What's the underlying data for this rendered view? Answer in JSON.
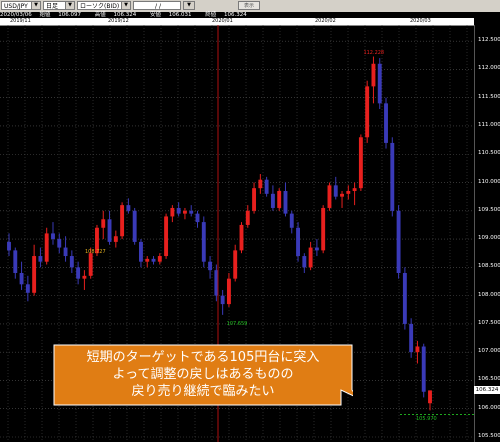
{
  "toolbar": {
    "symbol": "USD/JPY",
    "timeframe": "日足",
    "price_type": "ローソク(BID)",
    "date_input": "/ /",
    "show_button": "表示"
  },
  "info": {
    "date": "2020/03/06",
    "open_label": "始値",
    "open": "106.097",
    "high_label": "高値",
    "high": "106.324",
    "low_label": "安値",
    "low": "106.031",
    "close_label": "終値",
    "close": "106.324"
  },
  "date_axis": [
    "2019/11",
    "2019/12",
    "2020/01",
    "2020/02",
    "2020/03"
  ],
  "price_axis": [
    "112.500",
    "112.000",
    "111.500",
    "111.000",
    "110.500",
    "110.000",
    "109.500",
    "109.000",
    "108.500",
    "108.000",
    "107.500",
    "107.000",
    "106.500",
    "106.000",
    "105.500"
  ],
  "current_price": "106.324",
  "annotations": {
    "high_1": "108.727",
    "low_1": "107.659",
    "high_2": "112.228",
    "low_2": "105.970"
  },
  "callout": {
    "line1": "短期のターゲットである105円台に突入",
    "line2": "よって調整の戻しはあるものの",
    "line3": "戻り売り継続で臨みたい"
  },
  "colors": {
    "bull": "#e8201e",
    "bear": "#3a3ab8",
    "callout_fill": "#e07d14",
    "callout_stroke": "#ffffff",
    "vline": "#b01010",
    "hline": "#22c022"
  },
  "chart_data": {
    "type": "candlestick",
    "ylim": [
      105.5,
      112.75
    ],
    "candles": [
      [
        108.95,
        109.1,
        108.7,
        108.8
      ],
      [
        108.8,
        108.85,
        108.3,
        108.4
      ],
      [
        108.4,
        108.6,
        108.1,
        108.2
      ],
      [
        108.2,
        108.35,
        107.9,
        108.05
      ],
      [
        108.05,
        108.9,
        108.0,
        108.7
      ],
      [
        108.7,
        108.85,
        108.5,
        108.6
      ],
      [
        108.6,
        109.2,
        108.55,
        109.1
      ],
      [
        109.1,
        109.3,
        108.9,
        109.0
      ],
      [
        109.0,
        109.1,
        108.75,
        108.85
      ],
      [
        108.85,
        109.05,
        108.6,
        108.7
      ],
      [
        108.7,
        108.8,
        108.4,
        108.5
      ],
      [
        108.5,
        108.6,
        108.2,
        108.3
      ],
      [
        108.3,
        108.45,
        108.1,
        108.35
      ],
      [
        108.35,
        108.85,
        108.3,
        108.75
      ],
      [
        108.75,
        109.25,
        108.7,
        109.2
      ],
      [
        109.2,
        109.5,
        109.0,
        109.35
      ],
      [
        109.35,
        109.5,
        108.9,
        108.95
      ],
      [
        108.95,
        109.15,
        108.85,
        109.05
      ],
      [
        109.05,
        109.65,
        109.0,
        109.6
      ],
      [
        109.6,
        109.72,
        109.45,
        109.5
      ],
      [
        109.5,
        109.55,
        108.9,
        108.95
      ],
      [
        108.95,
        109.0,
        108.5,
        108.6
      ],
      [
        108.6,
        108.7,
        108.5,
        108.65
      ],
      [
        108.65,
        108.7,
        108.55,
        108.6
      ],
      [
        108.6,
        108.75,
        108.55,
        108.7
      ],
      [
        108.7,
        109.45,
        108.65,
        109.4
      ],
      [
        109.4,
        109.6,
        109.3,
        109.55
      ],
      [
        109.55,
        109.65,
        109.4,
        109.45
      ],
      [
        109.45,
        109.55,
        109.35,
        109.5
      ],
      [
        109.5,
        109.6,
        109.4,
        109.45
      ],
      [
        109.45,
        109.5,
        109.2,
        109.3
      ],
      [
        109.3,
        109.4,
        108.5,
        108.6
      ],
      [
        108.6,
        108.7,
        108.3,
        108.45
      ],
      [
        108.45,
        108.55,
        107.9,
        108.0
      ],
      [
        108.0,
        108.1,
        107.66,
        107.85
      ],
      [
        107.85,
        108.4,
        107.8,
        108.3
      ],
      [
        108.3,
        108.9,
        108.25,
        108.8
      ],
      [
        108.8,
        109.3,
        108.75,
        109.25
      ],
      [
        109.25,
        109.6,
        109.2,
        109.5
      ],
      [
        109.5,
        110.0,
        109.45,
        109.9
      ],
      [
        109.9,
        110.15,
        109.8,
        110.05
      ],
      [
        110.05,
        110.1,
        109.75,
        109.8
      ],
      [
        109.8,
        109.95,
        109.5,
        109.55
      ],
      [
        109.55,
        109.9,
        109.5,
        109.85
      ],
      [
        109.85,
        110.0,
        109.4,
        109.45
      ],
      [
        109.45,
        109.5,
        109.1,
        109.2
      ],
      [
        109.2,
        109.3,
        108.6,
        108.7
      ],
      [
        108.7,
        108.75,
        108.4,
        108.5
      ],
      [
        108.5,
        108.95,
        108.45,
        108.85
      ],
      [
        108.85,
        109.0,
        108.7,
        108.8
      ],
      [
        108.8,
        109.6,
        108.75,
        109.55
      ],
      [
        109.55,
        110.0,
        109.5,
        109.95
      ],
      [
        109.95,
        110.1,
        109.7,
        109.75
      ],
      [
        109.75,
        109.85,
        109.55,
        109.8
      ],
      [
        109.8,
        109.95,
        109.7,
        109.85
      ],
      [
        109.85,
        110.0,
        109.6,
        109.9
      ],
      [
        109.9,
        110.85,
        109.85,
        110.8
      ],
      [
        110.8,
        111.8,
        110.7,
        111.7
      ],
      [
        111.7,
        112.228,
        111.4,
        112.1
      ],
      [
        112.1,
        112.2,
        111.3,
        111.4
      ],
      [
        111.4,
        111.5,
        110.6,
        110.7
      ],
      [
        110.7,
        110.8,
        109.4,
        109.5
      ],
      [
        109.5,
        109.6,
        108.3,
        108.4
      ],
      [
        108.4,
        108.5,
        107.4,
        107.5
      ],
      [
        107.5,
        107.6,
        106.9,
        107.0
      ],
      [
        107.0,
        107.2,
        106.8,
        107.1
      ],
      [
        107.1,
        107.15,
        106.2,
        106.3
      ],
      [
        106.097,
        106.324,
        105.97,
        106.324
      ]
    ]
  }
}
